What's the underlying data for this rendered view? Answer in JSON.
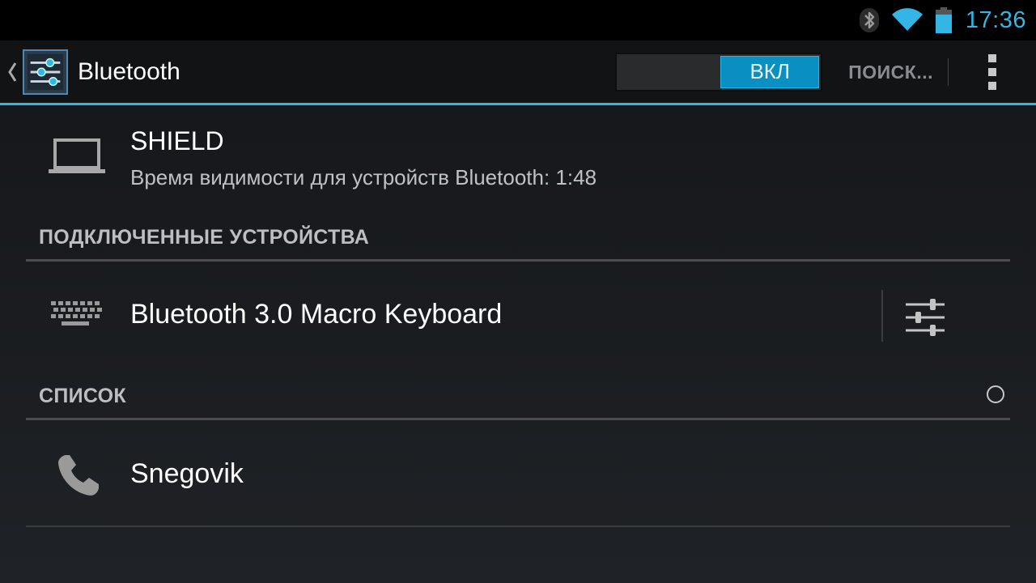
{
  "status_bar": {
    "time": "17:36",
    "icons": [
      "bluetooth-icon",
      "wifi-icon",
      "battery-icon"
    ],
    "accent_color": "#33b5e5"
  },
  "action_bar": {
    "title": "Bluetooth",
    "toggle_label": "ВКЛ",
    "search_label": "ПОИСК...",
    "icons": [
      "up-caret-icon",
      "settings-app-icon",
      "overflow-menu-icon"
    ]
  },
  "device": {
    "name": "SHIELD",
    "visibility": "Время видимости для устройств Bluetooth: 1:48",
    "icon": "laptop-icon"
  },
  "paired": {
    "header": "ПОДКЛЮЧЕННЫЕ УСТРОЙСТВА",
    "items": [
      {
        "name": "Bluetooth 3.0 Macro Keyboard",
        "icon": "keyboard-icon",
        "action_icon": "settings-sliders-icon"
      }
    ]
  },
  "available": {
    "header": "СПИСОК",
    "scanning": true,
    "items": [
      {
        "name": "Snegovik",
        "icon": "phone-icon"
      }
    ]
  }
}
